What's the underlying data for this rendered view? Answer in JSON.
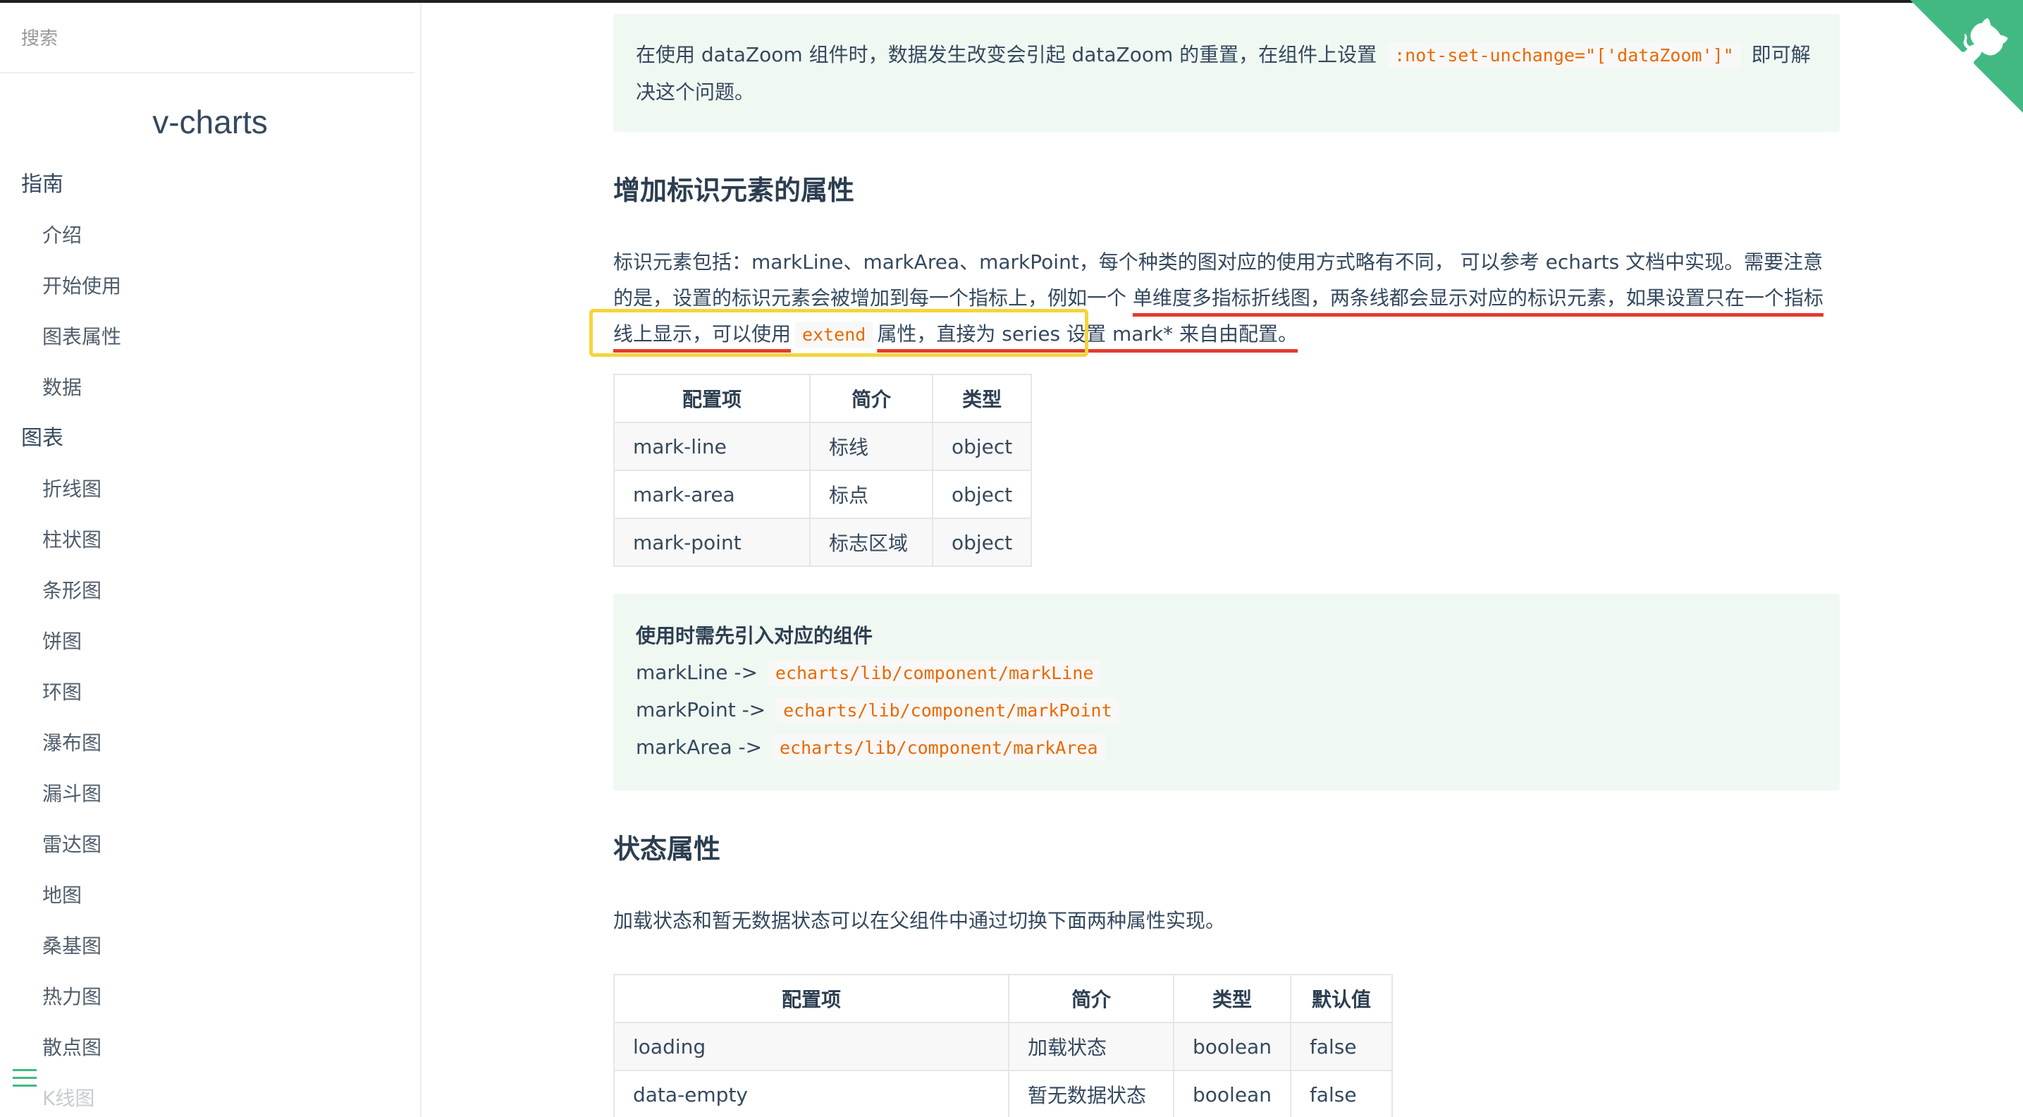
{
  "sidebar": {
    "search_placeholder": "搜索",
    "app_name": "v-charts",
    "groups": [
      {
        "label": "指南",
        "items": [
          "介绍",
          "开始使用",
          "图表属性",
          "数据"
        ]
      },
      {
        "label": "图表",
        "items": [
          "折线图",
          "柱状图",
          "条形图",
          "饼图",
          "环图",
          "瀑布图",
          "漏斗图",
          "雷达图",
          "地图",
          "桑基图",
          "热力图",
          "散点图",
          "K线图"
        ]
      }
    ]
  },
  "tip_top": {
    "text_before": "在使用 dataZoom 组件时，数据发生改变会引起 dataZoom 的重置，在组件上设置",
    "code": ":not-set-unchange=\"['dataZoom']\"",
    "text_after": "即可解决这个问题。"
  },
  "section_mark": {
    "title": "增加标识元素的属性",
    "desc_1": "标识元素包括：markLine、markArea、markPoint，每个种类的图对应的使用方式略有不同，  可以参考 echarts 文档中实现。需要注意的是，设置的标识元素会被增加到每一个指标上，例如一个 ",
    "desc_underlined_1": "单维度多指标折线图，两条线都会显示对应的标识元素，如果设置只在一个指标线上显示，可以使用",
    "desc_code": "extend",
    "desc_underlined_2": "属性，直接为 series 设置 mark* 来自由配置。",
    "table": {
      "headers": [
        "配置项",
        "简介",
        "类型"
      ],
      "rows": [
        [
          "mark-line",
          "标线",
          "object"
        ],
        [
          "mark-area",
          "标点",
          "object"
        ],
        [
          "mark-point",
          "标志区域",
          "object"
        ]
      ]
    },
    "tip": {
      "title": "使用时需先引入对应的组件",
      "lines": [
        {
          "label": "markLine ->",
          "code": "echarts/lib/component/markLine"
        },
        {
          "label": "markPoint ->",
          "code": "echarts/lib/component/markPoint"
        },
        {
          "label": "markArea ->",
          "code": "echarts/lib/component/markArea"
        }
      ]
    }
  },
  "section_state": {
    "title": "状态属性",
    "desc": "加载状态和暂无数据状态可以在父组件中通过切换下面两种属性实现。",
    "table": {
      "headers": [
        "配置项",
        "简介",
        "类型",
        "默认值"
      ],
      "rows": [
        [
          "loading",
          "加载状态",
          "boolean",
          "false"
        ],
        [
          "data-empty",
          "暂无数据状态",
          "boolean",
          "false"
        ]
      ]
    }
  },
  "colors": {
    "accent": "#42b983",
    "code": "#e96900",
    "tip_bg": "#f0f8f2",
    "annotation_red": "#e53a2e",
    "annotation_yellow": "#f6d43a"
  },
  "icons": {
    "corner": "github-octocat-icon",
    "menu": "hamburger-menu-icon"
  }
}
